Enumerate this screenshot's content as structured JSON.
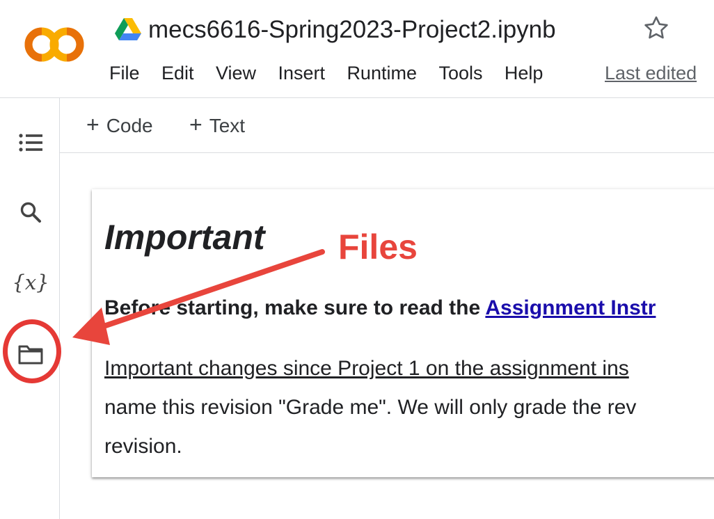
{
  "header": {
    "logo_text": "CO",
    "title": "mecs6616-Spring2023-Project2.ipynb",
    "menu": [
      "File",
      "Edit",
      "View",
      "Insert",
      "Runtime",
      "Tools",
      "Help"
    ],
    "last_edited": "Last edited"
  },
  "toolbar": {
    "code_label": "Code",
    "text_label": "Text"
  },
  "sidebar": {
    "items": [
      "table-of-contents",
      "search",
      "variables",
      "files"
    ],
    "variables_glyph": "{x}"
  },
  "cell": {
    "heading": "Important",
    "line1_bold": "Before starting, make sure to read the ",
    "line1_link": "Assignment Instr",
    "para_line1": "Important changes since Project 1 on the assignment ins",
    "para_line2": "name this revision \"Grade me\". We will only grade the rev",
    "para_line3": "revision."
  },
  "annotation": {
    "label": "Files",
    "color": "#e8453c"
  }
}
